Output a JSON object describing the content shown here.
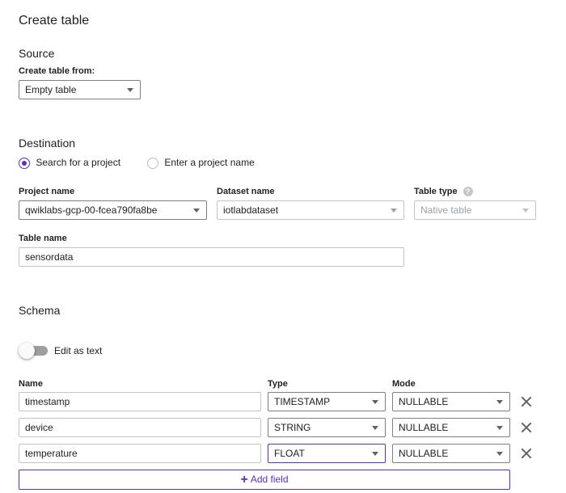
{
  "page": {
    "title": "Create table"
  },
  "source": {
    "heading": "Source",
    "create_from_label": "Create table from:",
    "create_from_value": "Empty table"
  },
  "destination": {
    "heading": "Destination",
    "radio_search": "Search for a project",
    "radio_enter": "Enter a project name",
    "selected_radio": "search",
    "project_label": "Project name",
    "project_value": "qwiklabs-gcp-00-fcea790fa8be",
    "dataset_label": "Dataset name",
    "dataset_value": "iotlabdataset",
    "table_type_label": "Table type",
    "table_type_help": "?",
    "table_type_value": "Native table",
    "table_name_label": "Table name",
    "table_name_value": "sensordata"
  },
  "schema": {
    "heading": "Schema",
    "edit_as_text_label": "Edit as text",
    "edit_as_text_on": false,
    "col_name": "Name",
    "col_type": "Type",
    "col_mode": "Mode",
    "fields": [
      {
        "name": "timestamp",
        "type": "TIMESTAMP",
        "mode": "NULLABLE"
      },
      {
        "name": "device",
        "type": "STRING",
        "mode": "NULLABLE"
      },
      {
        "name": "temperature",
        "type": "FLOAT",
        "mode": "NULLABLE"
      }
    ],
    "add_field_label": "Add field",
    "add_field_icon": "+"
  },
  "colors": {
    "accent": "#5f2bc4",
    "border": "#c4c4c4",
    "text": "#202124"
  }
}
